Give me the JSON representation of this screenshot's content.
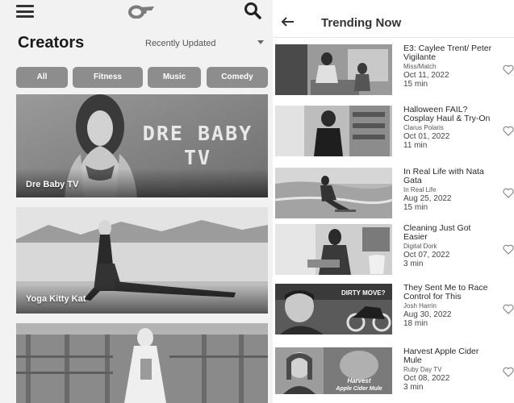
{
  "left": {
    "topbar": {
      "menu_icon": "hamburger-icon",
      "logo_icon": "brand-logo-icon",
      "search_icon": "search-icon"
    },
    "title": "Creators",
    "sort": {
      "selected": "Recently Updated",
      "icon": "caret-down-icon"
    },
    "chips": [
      "All",
      "Fitness",
      "Music",
      "Comedy"
    ],
    "cards": [
      {
        "name": "Dre Baby TV",
        "wordmark_line1": "DRE BABY",
        "wordmark_line2": "TV"
      },
      {
        "name": "Yoga Kitty Kat"
      },
      {
        "name": ""
      }
    ]
  },
  "right": {
    "back_icon": "arrow-left-icon",
    "title": "Trending Now",
    "videos": [
      {
        "title": "E3: Caylee Trent/ Peter Vigilante",
        "channel": "Miss/Match",
        "date": "Oct 11, 2022",
        "duration": "15 min"
      },
      {
        "title": "Halloween FAIL? Cosplay Haul & Try-On",
        "channel": "Clarus Polaris",
        "date": "Oct 01, 2022",
        "duration": "11 min"
      },
      {
        "title": "In Real Life with Nata Gata",
        "channel": "In Real Life",
        "date": "Aug 25, 2022",
        "duration": "15 min"
      },
      {
        "title": "Cleaning Just Got Easier",
        "channel": "Digital Dork",
        "date": "Oct 07, 2022",
        "duration": "3 min"
      },
      {
        "title": "They Sent Me to Race Control for This",
        "channel": "Josh Harrin",
        "date": "Aug 30, 2022",
        "duration": "18 min",
        "thumb_text": "DIRTY MOVE?"
      },
      {
        "title": "Harvest Apple Cider Mule",
        "channel": "Ruby Day TV",
        "date": "Oct 08, 2022",
        "duration": "3 min",
        "thumb_text_1": "Harvest",
        "thumb_text_2": "Apple Cider Mule"
      }
    ],
    "heart_icon": "heart-outline-icon"
  }
}
